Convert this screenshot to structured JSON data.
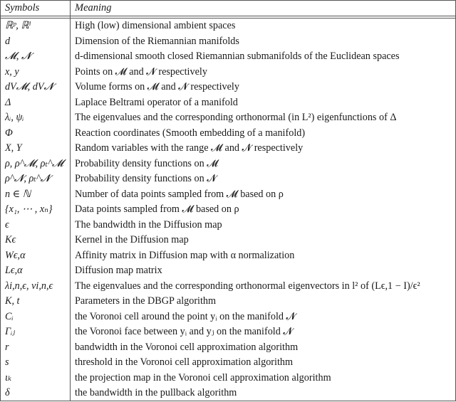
{
  "table": {
    "headers": {
      "symbols": "Symbols",
      "meaning": "Meaning"
    },
    "rows": [
      {
        "symbol": "ℝᵖ, ℝˡ",
        "meaning": "High (low) dimensional ambient spaces"
      },
      {
        "symbol": "d",
        "meaning": "Dimension of the Riemannian manifolds"
      },
      {
        "symbol": "𝓜, 𝓝",
        "meaning": "d-dimensional smooth closed Riemannian submanifolds of the Euclidean spaces"
      },
      {
        "symbol": "x, y",
        "meaning": "Points on 𝓜 and 𝓝 respectively"
      },
      {
        "symbol": "dV𝓜, dV𝓝",
        "meaning": "Volume forms on 𝓜 and 𝓝 respectively"
      },
      {
        "symbol": "Δ",
        "meaning": "Laplace Beltrami operator of a manifold"
      },
      {
        "symbol": "λᵢ, ψᵢ",
        "meaning": "The eigenvalues and the corresponding orthonormal (in L²) eigenfunctions of Δ"
      },
      {
        "symbol": "Φ",
        "meaning": "Reaction coordinates (Smooth embedding of a manifold)"
      },
      {
        "symbol": "X, Y",
        "meaning": "Random variables with the range 𝓜 and 𝓝 respectively"
      },
      {
        "symbol": "ρ, ρ^𝓜, ρₜ^𝓜",
        "meaning": "Probability density functions on 𝓜"
      },
      {
        "symbol": "ρ^𝓝, ρₜ^𝓝",
        "meaning": "Probability density functions on 𝓝"
      },
      {
        "symbol": "n ∈ ℕ",
        "meaning": "Number of data points sampled from 𝓜 based on ρ"
      },
      {
        "symbol": "{x₁, ⋯ , xₙ}",
        "meaning": "Data points sampled from 𝓜 based on ρ"
      },
      {
        "symbol": "ϵ",
        "meaning": "The bandwidth in the Diffusion map"
      },
      {
        "symbol": "Kϵ",
        "meaning": "Kernel in the Diffusion map"
      },
      {
        "symbol": "Wϵ,α",
        "meaning": "Affinity matrix in Diffusion map with α normalization"
      },
      {
        "symbol": "Lϵ,α",
        "meaning": "Diffusion map matrix"
      },
      {
        "symbol": "λi,n,ϵ, vi,n,ϵ",
        "meaning": "The eigenvalues and the corresponding orthonormal eigenvectors in l² of (Lϵ,1 − I)/ϵ²"
      },
      {
        "symbol": "K, t",
        "meaning": "Parameters in the DBGP algorithm"
      },
      {
        "symbol": "Cᵢ",
        "meaning": "the Voronoi cell around the point yᵢ on the manifold 𝓝"
      },
      {
        "symbol": "Γᵢⱼ",
        "meaning": "the Voronoi face between yᵢ and yⱼ on the manifold 𝓝"
      },
      {
        "symbol": "r",
        "meaning": "bandwidth in the Voronoi cell approximation algorithm"
      },
      {
        "symbol": "s",
        "meaning": "threshold in the Voronoi cell approximation algorithm"
      },
      {
        "symbol": "ιₖ",
        "meaning": "the projection map in the Voronoi cell approximation algorithm"
      },
      {
        "symbol": "δ",
        "meaning": "the bandwidth in the pullback algorithm"
      }
    ]
  }
}
